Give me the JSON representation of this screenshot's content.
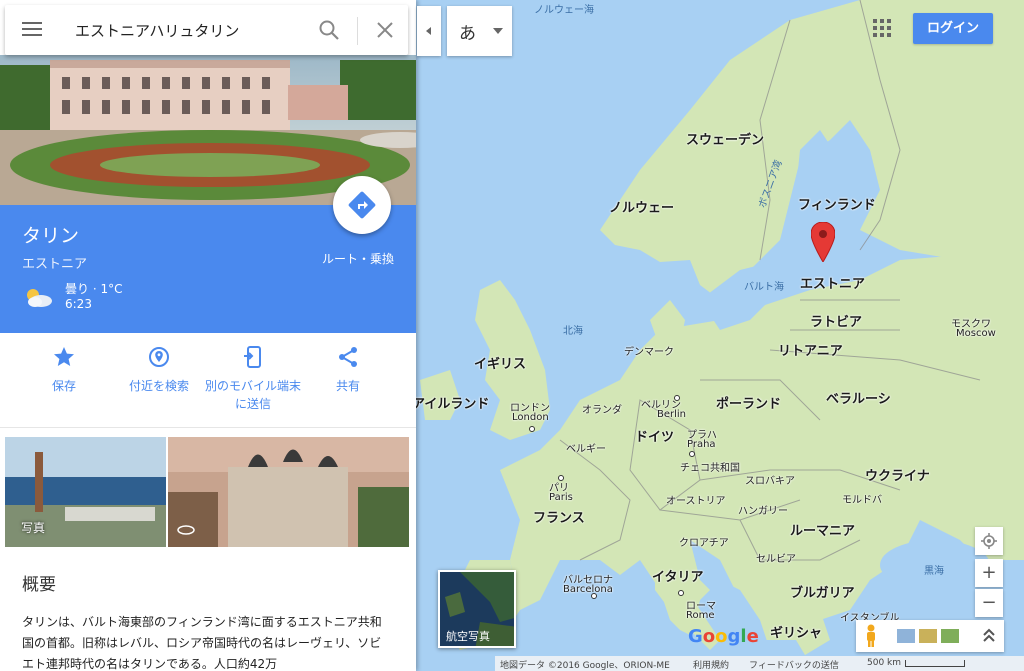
{
  "search": {
    "query": "エストニアハリュタリン"
  },
  "place": {
    "title": "タリン",
    "country": "エストニア",
    "weather": "曇り · 1°C",
    "time": "6:23",
    "route_label": "ルート・乗換"
  },
  "actions": [
    {
      "label": "保存",
      "icon": "star-icon"
    },
    {
      "label": "付近を検索",
      "icon": "nearby-icon"
    },
    {
      "label": "別のモバイル端末に送信",
      "icon": "send-to-phone-icon"
    },
    {
      "label": "共有",
      "icon": "share-icon"
    }
  ],
  "photos": {
    "label": "写真"
  },
  "overview": {
    "title": "概要",
    "text": "タリンは、バルト海東部のフィンランド湾に面するエストニア共和国の首都。旧称はレバル、ロシア帝国時代の名はレーヴェリ、ソビエト連邦時代の名はタリンである。人口約42万"
  },
  "ime": {
    "label": "あ"
  },
  "login": {
    "label": "ログイン"
  },
  "satellite": {
    "label": "航空写真"
  },
  "zoom": {
    "in": "+",
    "out": "−"
  },
  "google_logo": "Google",
  "footer": {
    "map_data": "地図データ ©2016 Google、ORION-ME",
    "terms": "利用規約",
    "feedback": "フィードバックの送信",
    "scale": "500 km"
  },
  "map": {
    "countries": [
      "スウェーデン",
      "フィンランド",
      "ノルウェー",
      "エストニア",
      "ラトビア",
      "リトアニア",
      "イギリス",
      "デンマーク",
      "ベラルーシ",
      "ポーランド",
      "アイルランド",
      "オランダ",
      "ドイツ",
      "ベルギー",
      "チェコ共和国",
      "ウクライナ",
      "フランス",
      "スロバキア",
      "オーストリア",
      "ハンガリー",
      "モルドバ",
      "ルーマニア",
      "クロアチア",
      "セルビア",
      "イタリア",
      "ブルガリア",
      "ギリシャ"
    ],
    "seas": [
      "ノルウェー海",
      "ボスニア湾",
      "バルト海",
      "北海",
      "黒海"
    ],
    "cities": [
      {
        "name": "モスクワ",
        "latin": "Moscow"
      },
      {
        "name": "ロンドン",
        "latin": "London"
      },
      {
        "name": "ベルリン",
        "latin": "Berlin"
      },
      {
        "name": "プラハ",
        "latin": "Praha"
      },
      {
        "name": "パリ",
        "latin": "Paris"
      },
      {
        "name": "バルセロナ",
        "latin": "Barcelona"
      },
      {
        "name": "ローマ",
        "latin": "Rome"
      },
      {
        "name": "イスタンブル",
        "latin": ""
      }
    ]
  },
  "colors": {
    "accent": "#4a89ee",
    "water": "#a8d0f3",
    "land": "#cfe3b0",
    "pin": "#e53935"
  }
}
